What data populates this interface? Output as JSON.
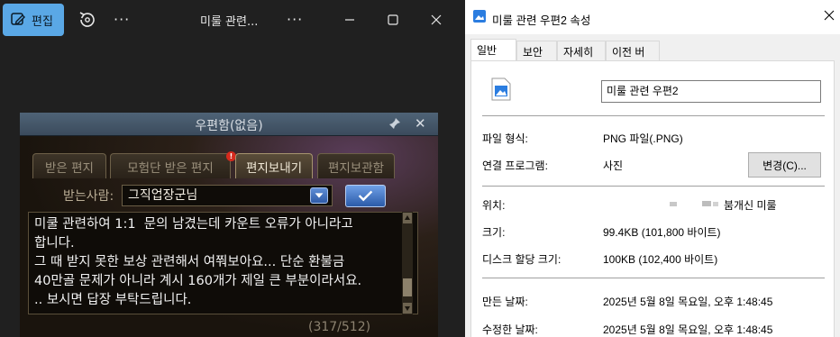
{
  "viewer": {
    "edit_label": "편집",
    "more": "···",
    "title": "미룰 관련...",
    "more2": "···"
  },
  "game": {
    "title": "우편함(없음)",
    "tabs": [
      {
        "label": "받은 편지",
        "active": false
      },
      {
        "label": "모험단 받은 편지",
        "active": false
      },
      {
        "label": "편지보내기",
        "active": true
      },
      {
        "label": "편지보관함",
        "active": false
      }
    ],
    "tab_badge": "!",
    "recipient_label": "받는사람:",
    "recipient_value": "그직업장군님",
    "message_lines": [
      "미쿨 관련하여 1:1  문의 남겼는데 카운트 오류가 아니라고",
      "합니다.",
      "그 때 받지 못한 보상 관련해서 여쭤보아요... 단순 환불금",
      "40만골 문제가 아니라 계시 160개가 제일 큰 부분이라서요.",
      ".. 보시면 답장 부탁드립니다."
    ],
    "counter": "(317/512)",
    "colors": {
      "accent_blue": "#2e5aa6",
      "active_tab_text": "#f2ead8"
    }
  },
  "props": {
    "title": "미룰 관련 우편2 속성",
    "tabs": [
      {
        "label": "일반",
        "active": true
      },
      {
        "label": "보안",
        "active": false
      },
      {
        "label": "자세히",
        "active": false
      },
      {
        "label": "이전 버전",
        "active": false
      }
    ],
    "filename": "미룰 관련 우편2",
    "file_type_label": "파일 형식:",
    "file_type_value": "PNG 파일(.PNG)",
    "opens_with_label": "연결 프로그램:",
    "opens_with_value": "사진",
    "change_button": "변경(C)...",
    "location_label": "위치:",
    "location_value": "붐개신 미룰",
    "size_label": "크기:",
    "size_value": "99.4KB (101,800 바이트)",
    "disk_size_label": "디스크 할당 크기:",
    "disk_size_value": "100KB (102,400 바이트)",
    "created_label": "만든 날짜:",
    "created_value": "2025년 5월 8일 목요일, 오후 1:48:45",
    "modified_label": "수정한 날짜:",
    "modified_value": "2025년 5월 8일 목요일, 오후 1:48:45"
  }
}
